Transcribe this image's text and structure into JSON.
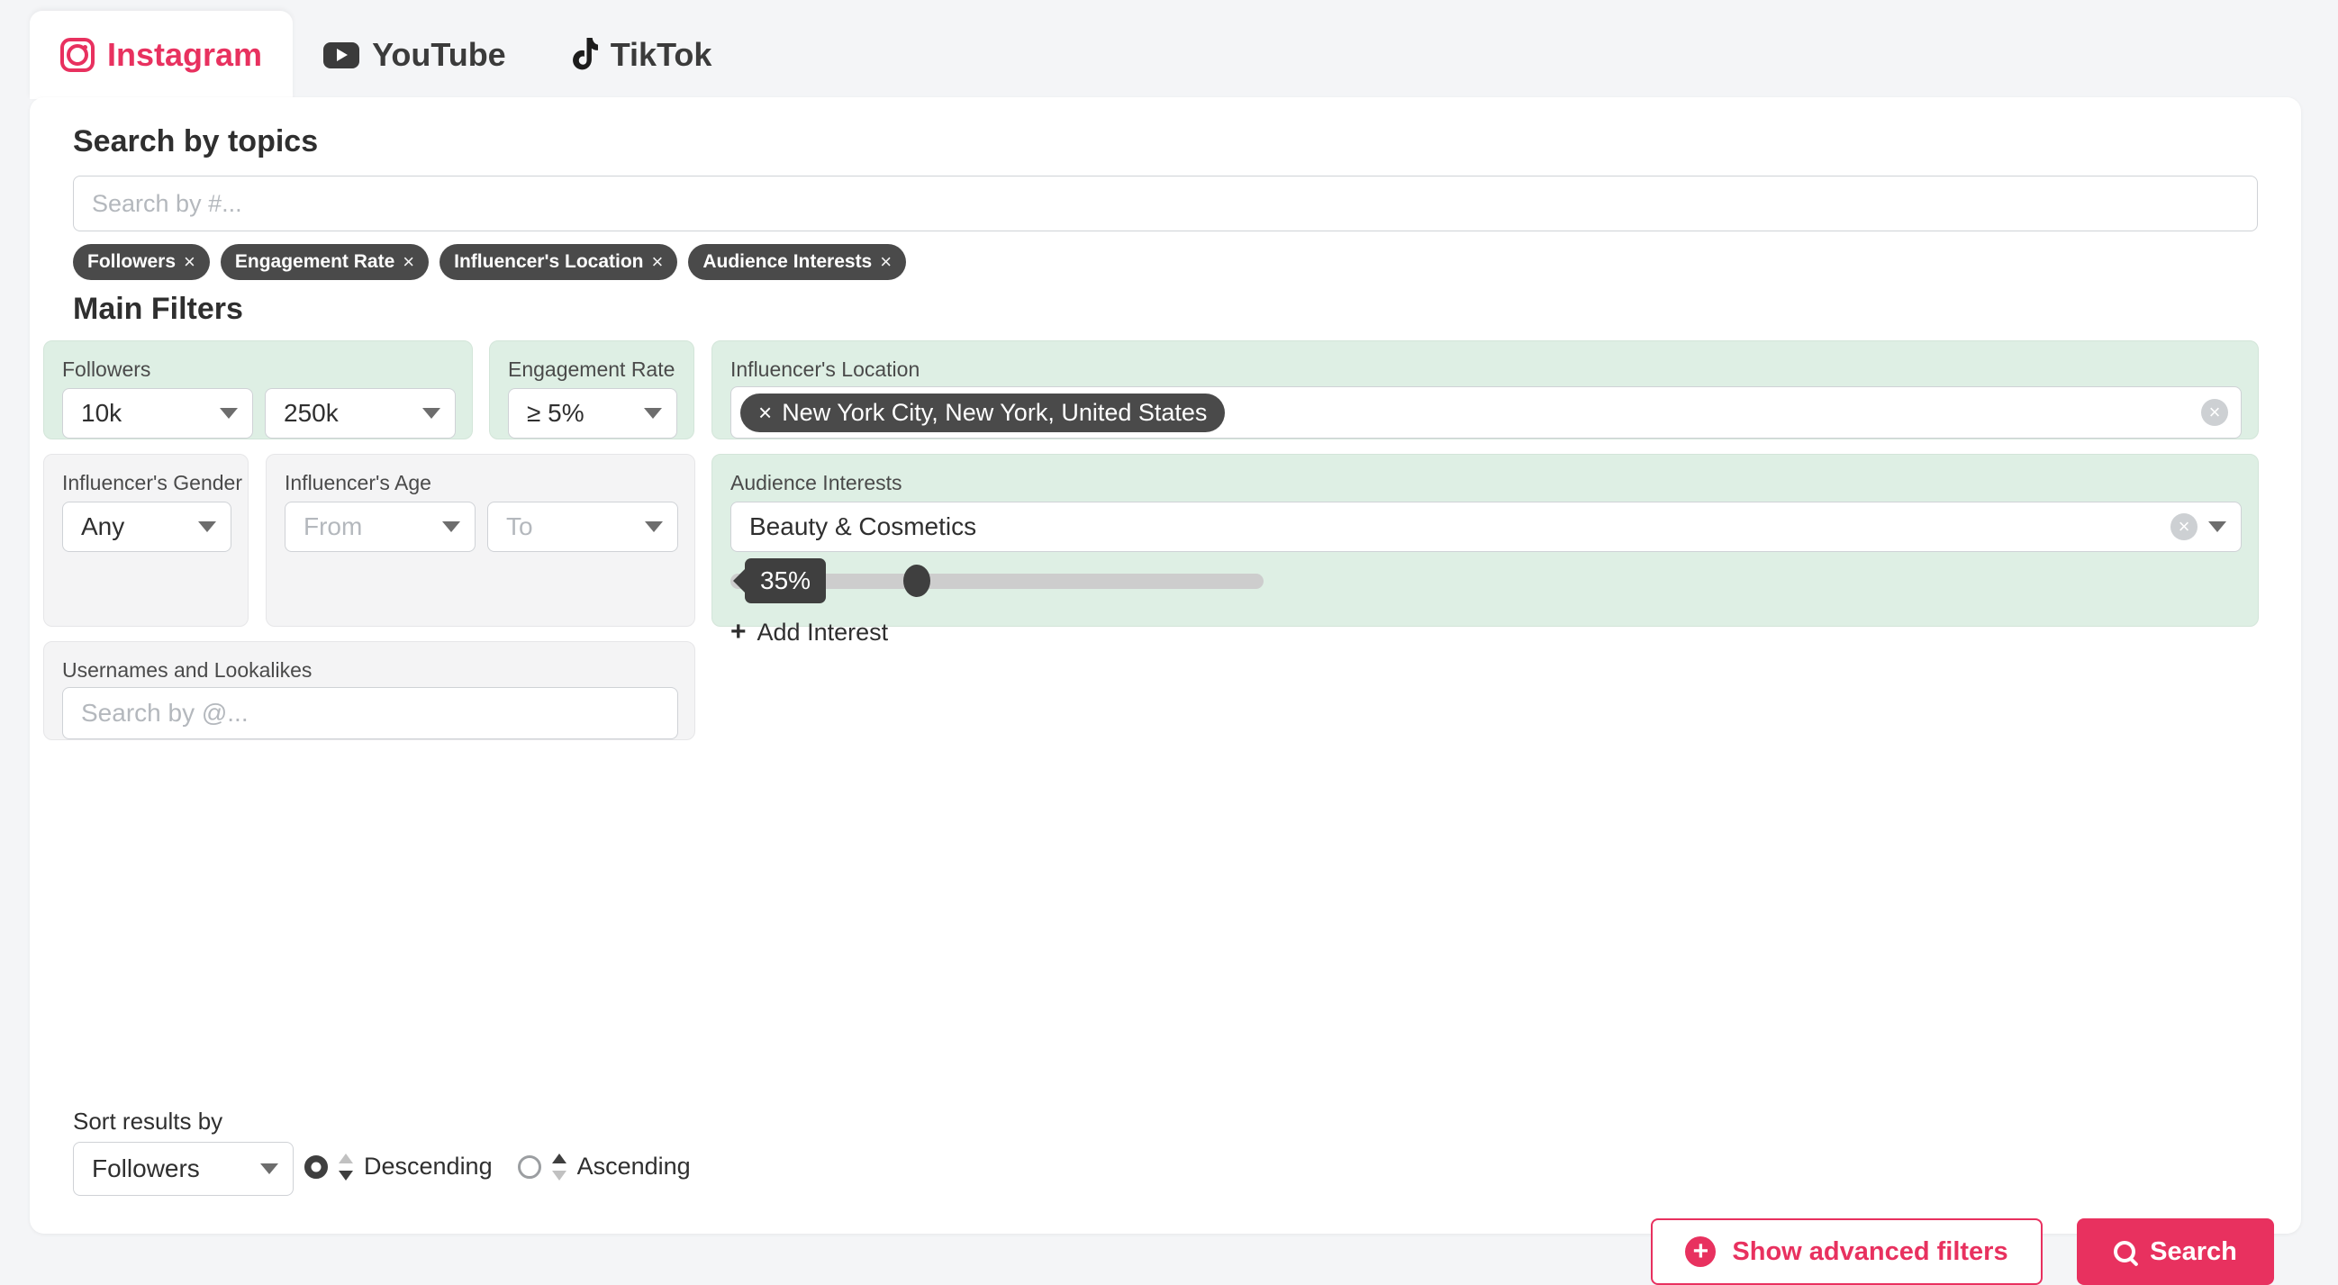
{
  "tabs": [
    {
      "label": "Instagram",
      "icon": "instagram-icon",
      "active": true
    },
    {
      "label": "YouTube",
      "icon": "youtube-icon",
      "active": false
    },
    {
      "label": "TikTok",
      "icon": "tiktok-icon",
      "active": false
    }
  ],
  "topics": {
    "title": "Search by topics",
    "placeholder": "Search by #...",
    "value": "",
    "chips": [
      {
        "label": "Followers",
        "remove": "×"
      },
      {
        "label": "Engagement Rate",
        "remove": "×"
      },
      {
        "label": "Influencer's Location",
        "remove": "×"
      },
      {
        "label": "Audience Interests",
        "remove": "×"
      }
    ]
  },
  "main_filters": {
    "title": "Main Filters",
    "followers": {
      "label": "Followers",
      "min": "10k",
      "max": "250k"
    },
    "engagement_rate": {
      "label": "Engagement Rate",
      "value": "≥ 5%"
    },
    "influencer_location": {
      "label": "Influencer's Location",
      "tag": "New York City, New York, United States",
      "tag_remove": "×",
      "clear": "×"
    },
    "influencer_gender": {
      "label": "Influencer's Gender",
      "value": "Any"
    },
    "influencer_age": {
      "label": "Influencer's Age",
      "from_placeholder": "From",
      "to_placeholder": "To"
    },
    "audience_interests": {
      "label": "Audience Interests",
      "value": "Beauty & Cosmetics",
      "clear": "×",
      "slider_value": "35%",
      "slider_percent": 35,
      "add_label": "Add Interest",
      "add_plus": "+"
    },
    "usernames": {
      "label": "Usernames and Lookalikes",
      "placeholder": "Search by @...",
      "value": ""
    }
  },
  "footer": {
    "sort_title": "Sort results by",
    "sort_value": "Followers",
    "descending_label": "Descending",
    "ascending_label": "Ascending",
    "selected_order": "descending",
    "advanced_label": "Show advanced filters",
    "advanced_plus": "+",
    "search_label": "Search"
  },
  "colors": {
    "accent": "#e8315f",
    "chip_bg": "#4a4a4a",
    "panel_green": "#deefe4",
    "panel_grey": "#f4f4f5",
    "page_bg": "#f4f5f7"
  }
}
